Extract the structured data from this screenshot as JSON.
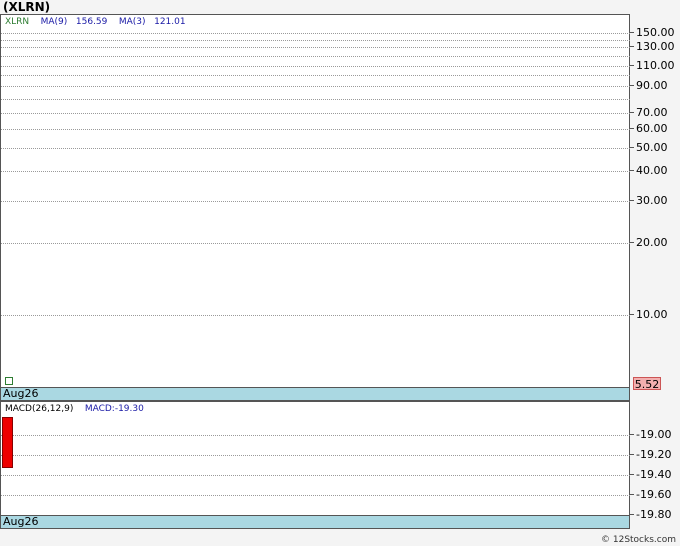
{
  "title": "(XLRN)",
  "price_panel": {
    "ticker": "XLRN",
    "ma9_label": "MA(9)",
    "ma9_value": "156.59",
    "ma3_label": "MA(3)",
    "ma3_value": "121.01",
    "last_price": "5.52",
    "date_label": "Aug26",
    "ticks": [
      "150.00",
      "130.00",
      "110.00",
      "90.00",
      "70.00",
      "60.00",
      "50.00",
      "40.00",
      "30.00",
      "20.00",
      "10.00"
    ]
  },
  "macd_panel": {
    "label": "MACD(26,12,9)",
    "macd_label": "MACD:",
    "macd_value": "-19.30",
    "date_label": "Aug26",
    "ticks": [
      "-19.00",
      "-19.20",
      "-19.40",
      "-19.60",
      "-19.80"
    ]
  },
  "credit": "© 12Stocks.com",
  "colors": {
    "ticker": "#2e7d32",
    "ma": "#1a1aa6",
    "macd_bar": "#ee0000",
    "strip": "#aad8e2",
    "price_box": "#f3b0b0"
  }
}
